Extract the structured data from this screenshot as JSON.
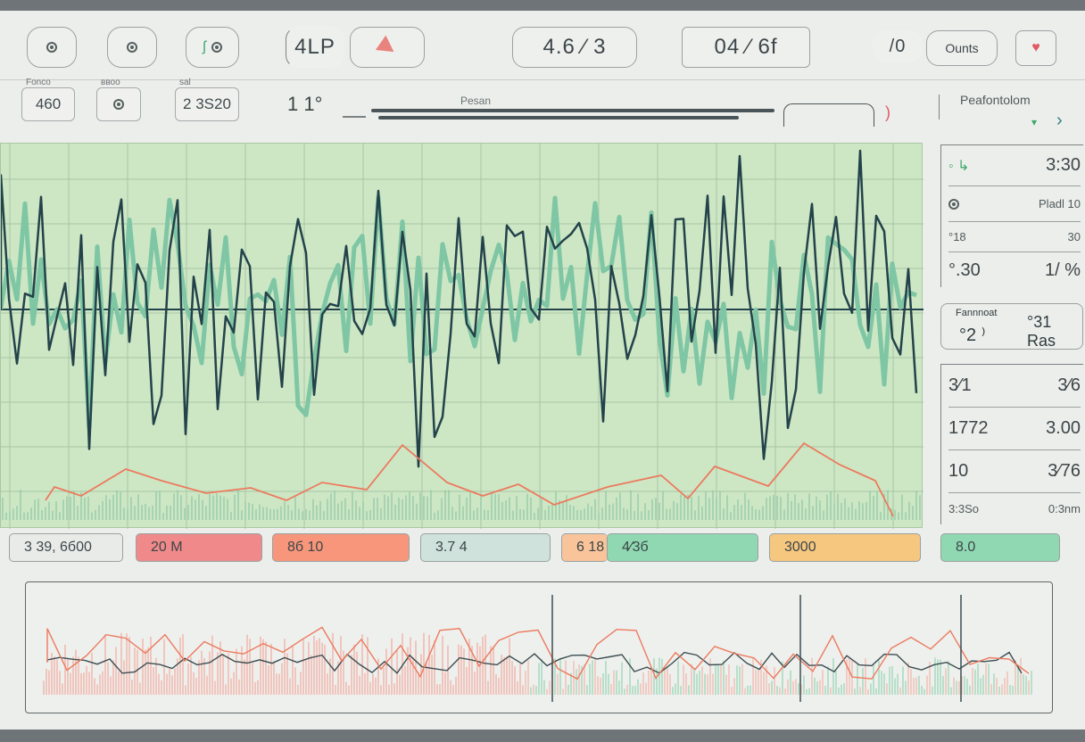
{
  "toolbar": {
    "display_a": "4LP",
    "display_b": "4.6 ⁄ 3",
    "display_c": "04 ⁄ 6f",
    "display_d": "/0",
    "counts_label": "Ounts",
    "icons": [
      "record-icon",
      "target-icon",
      "split-icon",
      "flag-icon",
      "heart-icon"
    ]
  },
  "row2": {
    "box1_caption": "Fonco",
    "box1_value": "460",
    "box2_caption": "ввоо",
    "box3_caption": "sal",
    "box3_value": "2 3S20",
    "value4": "1 1°",
    "center_label": "Pesan"
  },
  "sidebar": {
    "title": "Peafontolom",
    "rows": [
      {
        "l": "",
        "r": "3:30"
      },
      {
        "l": "",
        "r": "Pladl 10"
      },
      {
        "l": "°18",
        "r": "30"
      },
      {
        "l": "°.30",
        "r": "1/ %"
      }
    ],
    "card_label": "Fannnoat",
    "card_value": "°2 ⁾",
    "card_right": "°31 Ras",
    "rows2": [
      {
        "l": "3⁄1",
        "r": "3⁄6"
      },
      {
        "l": "1772",
        "r": "3.00"
      },
      {
        "l": "10",
        "r": "3⁄76"
      },
      {
        "l": "3:3So",
        "r": "0:3nm"
      }
    ]
  },
  "status_bars": [
    {
      "label": "3 39,   6б00",
      "color": "#e9ebe9"
    },
    {
      "label": "20 M",
      "color": "#f08a8a"
    },
    {
      "label": "8б 10",
      "color": "#f7967a"
    },
    {
      "label": "3.7 4",
      "color": "#cfe3dc"
    },
    {
      "label": "6 18",
      "color": "#f9c49a"
    },
    {
      "label": "4⁄3б",
      "color": "#8fd8b1"
    },
    {
      "label": "3000",
      "color": "#f6c77f"
    },
    {
      "label": "8.0",
      "color": "#8fd8b1"
    }
  ],
  "colors": {
    "wave_bg": "#cde7c5",
    "wave_dark": "#24424a",
    "wave_light": "#7fc6a4",
    "wave_red": "#ec7a5e",
    "accent_red": "#e05a63",
    "accent_green": "#3fa86b"
  }
}
